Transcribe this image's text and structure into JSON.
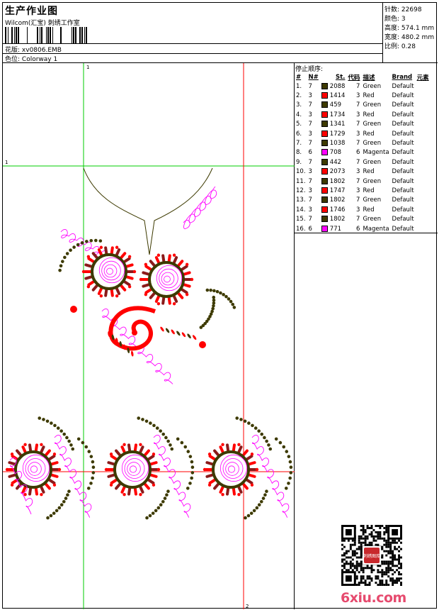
{
  "header": {
    "title": "生产作业图",
    "company": "Wilcom(汇宝) 刺绣工作室",
    "design_label": "花版:",
    "design_value": "xv0806.EMB",
    "colorway_label": "色位:",
    "colorway_value": "Colorway 1"
  },
  "specs": [
    {
      "label": "针数:",
      "value": "22698"
    },
    {
      "label": "颜色:",
      "value": "3"
    },
    {
      "label": "高度:",
      "value": "574.1 mm"
    },
    {
      "label": "宽度:",
      "value": "480.2 mm"
    },
    {
      "label": "比例:",
      "value": "0.28"
    }
  ],
  "guides": {
    "top_left": "1",
    "left": "1",
    "bottom_right": "2"
  },
  "stops": {
    "title": "停止顺序:",
    "columns": [
      "#",
      "N#",
      "St.",
      "代码",
      "描述",
      "Brand",
      "元素"
    ],
    "colors": {
      "Green": "#3d3a00",
      "Red": "#ff0000",
      "Magenta": "#ff00ff"
    },
    "rows": [
      {
        "n": "1.",
        "needle": "7",
        "color": "#3d3a00",
        "st": "2088",
        "code": "7",
        "desc": "Green",
        "brand": "Default"
      },
      {
        "n": "2.",
        "needle": "3",
        "color": "#ff0000",
        "st": "1414",
        "code": "3",
        "desc": "Red",
        "brand": "Default"
      },
      {
        "n": "3.",
        "needle": "7",
        "color": "#3d3a00",
        "st": "459",
        "code": "7",
        "desc": "Green",
        "brand": "Default"
      },
      {
        "n": "4.",
        "needle": "3",
        "color": "#ff0000",
        "st": "1734",
        "code": "3",
        "desc": "Red",
        "brand": "Default"
      },
      {
        "n": "5.",
        "needle": "7",
        "color": "#3d3a00",
        "st": "1341",
        "code": "7",
        "desc": "Green",
        "brand": "Default"
      },
      {
        "n": "6.",
        "needle": "3",
        "color": "#ff0000",
        "st": "1729",
        "code": "3",
        "desc": "Red",
        "brand": "Default"
      },
      {
        "n": "7.",
        "needle": "7",
        "color": "#3d3a00",
        "st": "1038",
        "code": "7",
        "desc": "Green",
        "brand": "Default"
      },
      {
        "n": "8.",
        "needle": "6",
        "color": "#ff00ff",
        "st": "708",
        "code": "6",
        "desc": "Magenta",
        "brand": "Default"
      },
      {
        "n": "9.",
        "needle": "7",
        "color": "#3d3a00",
        "st": "442",
        "code": "7",
        "desc": "Green",
        "brand": "Default"
      },
      {
        "n": "10.",
        "needle": "3",
        "color": "#ff0000",
        "st": "2073",
        "code": "3",
        "desc": "Red",
        "brand": "Default"
      },
      {
        "n": "11.",
        "needle": "7",
        "color": "#3d3a00",
        "st": "1802",
        "code": "7",
        "desc": "Green",
        "brand": "Default"
      },
      {
        "n": "12.",
        "needle": "3",
        "color": "#ff0000",
        "st": "1747",
        "code": "3",
        "desc": "Red",
        "brand": "Default"
      },
      {
        "n": "13.",
        "needle": "7",
        "color": "#3d3a00",
        "st": "1802",
        "code": "7",
        "desc": "Green",
        "brand": "Default"
      },
      {
        "n": "14.",
        "needle": "3",
        "color": "#ff0000",
        "st": "1746",
        "code": "3",
        "desc": "Red",
        "brand": "Default"
      },
      {
        "n": "15.",
        "needle": "7",
        "color": "#3d3a00",
        "st": "1802",
        "code": "7",
        "desc": "Green",
        "brand": "Default"
      },
      {
        "n": "16.",
        "needle": "6",
        "color": "#ff00ff",
        "st": "771",
        "code": "6",
        "desc": "Magenta",
        "brand": "Default"
      }
    ]
  },
  "watermark": "6xiu.com",
  "qr_stamp": "刺绣图库"
}
